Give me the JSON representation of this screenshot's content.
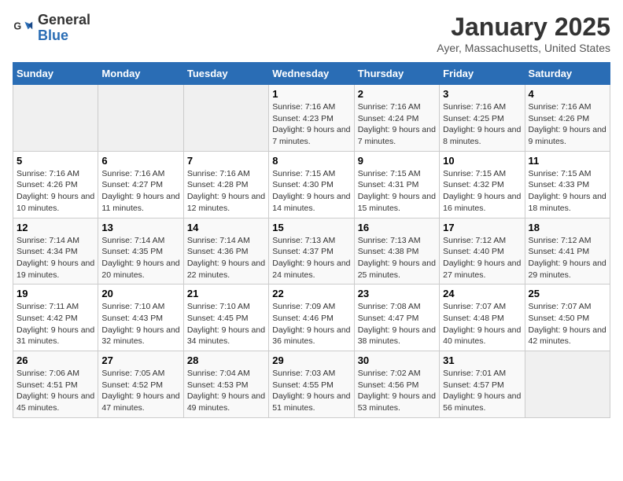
{
  "header": {
    "logo_line1": "General",
    "logo_line2": "Blue",
    "month_title": "January 2025",
    "location": "Ayer, Massachusetts, United States"
  },
  "weekdays": [
    "Sunday",
    "Monday",
    "Tuesday",
    "Wednesday",
    "Thursday",
    "Friday",
    "Saturday"
  ],
  "weeks": [
    [
      {
        "day": "",
        "info": ""
      },
      {
        "day": "",
        "info": ""
      },
      {
        "day": "",
        "info": ""
      },
      {
        "day": "1",
        "info": "Sunrise: 7:16 AM\nSunset: 4:23 PM\nDaylight: 9 hours and 7 minutes."
      },
      {
        "day": "2",
        "info": "Sunrise: 7:16 AM\nSunset: 4:24 PM\nDaylight: 9 hours and 7 minutes."
      },
      {
        "day": "3",
        "info": "Sunrise: 7:16 AM\nSunset: 4:25 PM\nDaylight: 9 hours and 8 minutes."
      },
      {
        "day": "4",
        "info": "Sunrise: 7:16 AM\nSunset: 4:26 PM\nDaylight: 9 hours and 9 minutes."
      }
    ],
    [
      {
        "day": "5",
        "info": "Sunrise: 7:16 AM\nSunset: 4:26 PM\nDaylight: 9 hours and 10 minutes."
      },
      {
        "day": "6",
        "info": "Sunrise: 7:16 AM\nSunset: 4:27 PM\nDaylight: 9 hours and 11 minutes."
      },
      {
        "day": "7",
        "info": "Sunrise: 7:16 AM\nSunset: 4:28 PM\nDaylight: 9 hours and 12 minutes."
      },
      {
        "day": "8",
        "info": "Sunrise: 7:15 AM\nSunset: 4:30 PM\nDaylight: 9 hours and 14 minutes."
      },
      {
        "day": "9",
        "info": "Sunrise: 7:15 AM\nSunset: 4:31 PM\nDaylight: 9 hours and 15 minutes."
      },
      {
        "day": "10",
        "info": "Sunrise: 7:15 AM\nSunset: 4:32 PM\nDaylight: 9 hours and 16 minutes."
      },
      {
        "day": "11",
        "info": "Sunrise: 7:15 AM\nSunset: 4:33 PM\nDaylight: 9 hours and 18 minutes."
      }
    ],
    [
      {
        "day": "12",
        "info": "Sunrise: 7:14 AM\nSunset: 4:34 PM\nDaylight: 9 hours and 19 minutes."
      },
      {
        "day": "13",
        "info": "Sunrise: 7:14 AM\nSunset: 4:35 PM\nDaylight: 9 hours and 20 minutes."
      },
      {
        "day": "14",
        "info": "Sunrise: 7:14 AM\nSunset: 4:36 PM\nDaylight: 9 hours and 22 minutes."
      },
      {
        "day": "15",
        "info": "Sunrise: 7:13 AM\nSunset: 4:37 PM\nDaylight: 9 hours and 24 minutes."
      },
      {
        "day": "16",
        "info": "Sunrise: 7:13 AM\nSunset: 4:38 PM\nDaylight: 9 hours and 25 minutes."
      },
      {
        "day": "17",
        "info": "Sunrise: 7:12 AM\nSunset: 4:40 PM\nDaylight: 9 hours and 27 minutes."
      },
      {
        "day": "18",
        "info": "Sunrise: 7:12 AM\nSunset: 4:41 PM\nDaylight: 9 hours and 29 minutes."
      }
    ],
    [
      {
        "day": "19",
        "info": "Sunrise: 7:11 AM\nSunset: 4:42 PM\nDaylight: 9 hours and 31 minutes."
      },
      {
        "day": "20",
        "info": "Sunrise: 7:10 AM\nSunset: 4:43 PM\nDaylight: 9 hours and 32 minutes."
      },
      {
        "day": "21",
        "info": "Sunrise: 7:10 AM\nSunset: 4:45 PM\nDaylight: 9 hours and 34 minutes."
      },
      {
        "day": "22",
        "info": "Sunrise: 7:09 AM\nSunset: 4:46 PM\nDaylight: 9 hours and 36 minutes."
      },
      {
        "day": "23",
        "info": "Sunrise: 7:08 AM\nSunset: 4:47 PM\nDaylight: 9 hours and 38 minutes."
      },
      {
        "day": "24",
        "info": "Sunrise: 7:07 AM\nSunset: 4:48 PM\nDaylight: 9 hours and 40 minutes."
      },
      {
        "day": "25",
        "info": "Sunrise: 7:07 AM\nSunset: 4:50 PM\nDaylight: 9 hours and 42 minutes."
      }
    ],
    [
      {
        "day": "26",
        "info": "Sunrise: 7:06 AM\nSunset: 4:51 PM\nDaylight: 9 hours and 45 minutes."
      },
      {
        "day": "27",
        "info": "Sunrise: 7:05 AM\nSunset: 4:52 PM\nDaylight: 9 hours and 47 minutes."
      },
      {
        "day": "28",
        "info": "Sunrise: 7:04 AM\nSunset: 4:53 PM\nDaylight: 9 hours and 49 minutes."
      },
      {
        "day": "29",
        "info": "Sunrise: 7:03 AM\nSunset: 4:55 PM\nDaylight: 9 hours and 51 minutes."
      },
      {
        "day": "30",
        "info": "Sunrise: 7:02 AM\nSunset: 4:56 PM\nDaylight: 9 hours and 53 minutes."
      },
      {
        "day": "31",
        "info": "Sunrise: 7:01 AM\nSunset: 4:57 PM\nDaylight: 9 hours and 56 minutes."
      },
      {
        "day": "",
        "info": ""
      }
    ]
  ]
}
